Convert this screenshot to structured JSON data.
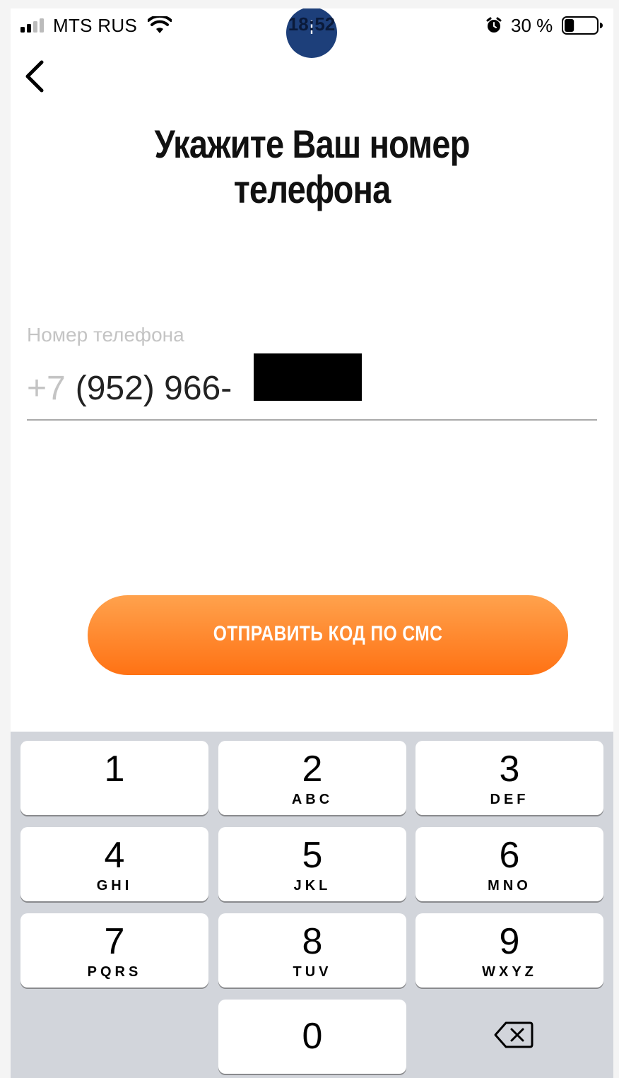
{
  "status_bar": {
    "carrier": "MTS RUS",
    "time": "18:52",
    "badge_glyph": "i",
    "battery_percent": "30 %",
    "battery_level": 0.3,
    "icons": [
      "signal-icon",
      "wifi-icon",
      "alarm-icon",
      "battery-icon"
    ]
  },
  "nav": {
    "back_icon": "chevron-left-icon"
  },
  "title": {
    "line1": "Укажите Ваш номер",
    "line2": "телефона"
  },
  "phone_field": {
    "label": "Номер телефона",
    "prefix": "+7",
    "value": "(952) 966-"
  },
  "submit": {
    "label": "ОТПРАВИТЬ КОД ПО СМС",
    "color_start": "#ffa24d",
    "color_end": "#ff7214"
  },
  "keypad": {
    "keys": [
      {
        "digit": "1",
        "letters": ""
      },
      {
        "digit": "2",
        "letters": "ABC"
      },
      {
        "digit": "3",
        "letters": "DEF"
      },
      {
        "digit": "4",
        "letters": "GHI"
      },
      {
        "digit": "5",
        "letters": "JKL"
      },
      {
        "digit": "6",
        "letters": "MNO"
      },
      {
        "digit": "7",
        "letters": "PQRS"
      },
      {
        "digit": "8",
        "letters": "TUV"
      },
      {
        "digit": "9",
        "letters": "WXYZ"
      },
      {
        "digit": "0",
        "letters": ""
      }
    ],
    "delete_icon": "backspace-icon"
  }
}
